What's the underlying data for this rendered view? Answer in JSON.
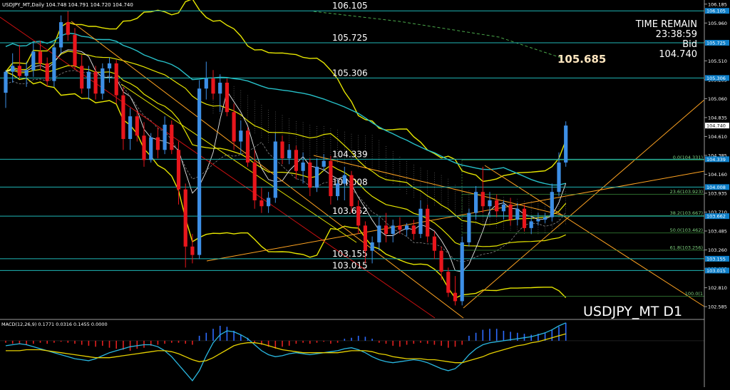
{
  "header": {
    "title_line": "USDJPY_MT,Daily  104.748 104.791 104.720 104.740"
  },
  "info_panel": {
    "time_remain_label": "TIME REMAIN",
    "time_remain_value": "23:38:59",
    "bid_label": "Bid",
    "bid_value": "104.740"
  },
  "highlight_price": "105.685",
  "symbol_label": "USDJPY_MT D1",
  "colors": {
    "background": "#000000",
    "bull": "#3d8fe6",
    "bear": "#e8161c",
    "level_line": "#1fb6b6",
    "bands": "#e6e600",
    "trend_orange": "#ffa321",
    "trend_red": "#cc1111",
    "ma_cyan": "#27c0c8",
    "price_tag": "#0e7fc9",
    "macd_pos": "#2d6bff",
    "macd_neg": "#e02020",
    "signal": "#e6d000",
    "macd_line": "#2ab7e0"
  },
  "chart_data": {
    "type": "candlestick",
    "symbol": "USDJPY_MT",
    "timeframe": "Daily",
    "ylim": [
      102.45,
      106.2
    ],
    "y_ticks": [
      106.185,
      105.96,
      105.735,
      105.51,
      105.285,
      105.06,
      104.835,
      104.61,
      104.385,
      104.16,
      103.935,
      103.71,
      103.485,
      103.26,
      103.035,
      102.81,
      102.585
    ],
    "current_price": 104.74,
    "candles": [
      {
        "o": 105.13,
        "h": 105.4,
        "l": 104.95,
        "c": 105.38
      },
      {
        "o": 105.38,
        "h": 105.6,
        "l": 105.25,
        "c": 105.45
      },
      {
        "o": 105.45,
        "h": 105.7,
        "l": 105.3,
        "c": 105.33
      },
      {
        "o": 105.33,
        "h": 105.5,
        "l": 105.2,
        "c": 105.4
      },
      {
        "o": 105.4,
        "h": 105.72,
        "l": 105.32,
        "c": 105.62
      },
      {
        "o": 105.62,
        "h": 105.75,
        "l": 105.4,
        "c": 105.48
      },
      {
        "o": 105.48,
        "h": 105.55,
        "l": 105.2,
        "c": 105.27
      },
      {
        "o": 105.27,
        "h": 105.72,
        "l": 105.2,
        "c": 105.67
      },
      {
        "o": 105.67,
        "h": 106.05,
        "l": 105.6,
        "c": 105.97
      },
      {
        "o": 105.97,
        "h": 106.1,
        "l": 105.75,
        "c": 105.82
      },
      {
        "o": 105.82,
        "h": 105.9,
        "l": 105.4,
        "c": 105.45
      },
      {
        "o": 105.45,
        "h": 105.58,
        "l": 105.12,
        "c": 105.18
      },
      {
        "o": 105.18,
        "h": 105.45,
        "l": 105.05,
        "c": 105.38
      },
      {
        "o": 105.38,
        "h": 105.45,
        "l": 105.05,
        "c": 105.12
      },
      {
        "o": 105.12,
        "h": 105.48,
        "l": 105.05,
        "c": 105.42
      },
      {
        "o": 105.42,
        "h": 105.55,
        "l": 105.25,
        "c": 105.48
      },
      {
        "o": 105.48,
        "h": 105.52,
        "l": 105.0,
        "c": 105.1
      },
      {
        "o": 105.1,
        "h": 105.2,
        "l": 104.45,
        "c": 104.58
      },
      {
        "o": 104.58,
        "h": 104.95,
        "l": 104.45,
        "c": 104.85
      },
      {
        "o": 104.85,
        "h": 104.92,
        "l": 104.55,
        "c": 104.62
      },
      {
        "o": 104.62,
        "h": 104.78,
        "l": 104.25,
        "c": 104.33
      },
      {
        "o": 104.33,
        "h": 104.65,
        "l": 104.3,
        "c": 104.6
      },
      {
        "o": 104.6,
        "h": 104.72,
        "l": 104.35,
        "c": 104.45
      },
      {
        "o": 104.45,
        "h": 104.85,
        "l": 104.4,
        "c": 104.75
      },
      {
        "o": 104.75,
        "h": 104.8,
        "l": 104.4,
        "c": 104.45
      },
      {
        "o": 104.45,
        "h": 104.55,
        "l": 103.8,
        "c": 103.98
      },
      {
        "o": 103.98,
        "h": 104.05,
        "l": 103.05,
        "c": 103.3
      },
      {
        "o": 103.3,
        "h": 103.45,
        "l": 103.1,
        "c": 103.2
      },
      {
        "o": 103.2,
        "h": 105.28,
        "l": 103.15,
        "c": 105.18
      },
      {
        "o": 105.18,
        "h": 105.5,
        "l": 105.05,
        "c": 105.3
      },
      {
        "o": 105.3,
        "h": 105.4,
        "l": 105.05,
        "c": 105.12
      },
      {
        "o": 105.12,
        "h": 105.35,
        "l": 104.9,
        "c": 105.25
      },
      {
        "o": 105.25,
        "h": 105.3,
        "l": 104.85,
        "c": 104.9
      },
      {
        "o": 104.9,
        "h": 105.0,
        "l": 104.45,
        "c": 104.55
      },
      {
        "o": 104.55,
        "h": 104.8,
        "l": 104.4,
        "c": 104.68
      },
      {
        "o": 104.68,
        "h": 104.72,
        "l": 104.25,
        "c": 104.3
      },
      {
        "o": 104.3,
        "h": 104.45,
        "l": 103.75,
        "c": 103.85
      },
      {
        "o": 103.85,
        "h": 104.0,
        "l": 103.7,
        "c": 103.78
      },
      {
        "o": 103.78,
        "h": 103.95,
        "l": 103.7,
        "c": 103.88
      },
      {
        "o": 103.88,
        "h": 104.65,
        "l": 103.82,
        "c": 104.55
      },
      {
        "o": 104.55,
        "h": 104.62,
        "l": 104.28,
        "c": 104.35
      },
      {
        "o": 104.35,
        "h": 104.52,
        "l": 104.28,
        "c": 104.45
      },
      {
        "o": 104.45,
        "h": 104.5,
        "l": 104.1,
        "c": 104.2
      },
      {
        "o": 104.2,
        "h": 104.42,
        "l": 104.05,
        "c": 104.3
      },
      {
        "o": 104.3,
        "h": 104.35,
        "l": 103.9,
        "c": 104.0
      },
      {
        "o": 104.0,
        "h": 104.35,
        "l": 103.95,
        "c": 104.25
      },
      {
        "o": 104.25,
        "h": 104.4,
        "l": 104.2,
        "c": 104.32
      },
      {
        "o": 104.32,
        "h": 104.38,
        "l": 103.8,
        "c": 103.9
      },
      {
        "o": 103.9,
        "h": 104.1,
        "l": 103.85,
        "c": 104.05
      },
      {
        "o": 104.05,
        "h": 104.25,
        "l": 103.85,
        "c": 104.15
      },
      {
        "o": 104.15,
        "h": 104.2,
        "l": 103.7,
        "c": 103.78
      },
      {
        "o": 103.78,
        "h": 103.85,
        "l": 103.45,
        "c": 103.55
      },
      {
        "o": 103.55,
        "h": 103.6,
        "l": 103.1,
        "c": 103.25
      },
      {
        "o": 103.25,
        "h": 103.42,
        "l": 103.1,
        "c": 103.35
      },
      {
        "o": 103.35,
        "h": 103.65,
        "l": 103.25,
        "c": 103.55
      },
      {
        "o": 103.55,
        "h": 103.7,
        "l": 103.35,
        "c": 103.45
      },
      {
        "o": 103.45,
        "h": 103.62,
        "l": 103.35,
        "c": 103.55
      },
      {
        "o": 103.55,
        "h": 103.65,
        "l": 103.45,
        "c": 103.5
      },
      {
        "o": 103.5,
        "h": 103.58,
        "l": 103.42,
        "c": 103.55
      },
      {
        "o": 103.55,
        "h": 103.62,
        "l": 103.38,
        "c": 103.45
      },
      {
        "o": 103.45,
        "h": 103.85,
        "l": 103.4,
        "c": 103.75
      },
      {
        "o": 103.75,
        "h": 103.8,
        "l": 103.35,
        "c": 103.42
      },
      {
        "o": 103.42,
        "h": 103.48,
        "l": 103.15,
        "c": 103.25
      },
      {
        "o": 103.25,
        "h": 103.3,
        "l": 102.9,
        "c": 103.0
      },
      {
        "o": 103.0,
        "h": 103.05,
        "l": 102.7,
        "c": 102.75
      },
      {
        "o": 102.75,
        "h": 102.95,
        "l": 102.6,
        "c": 102.65
      },
      {
        "o": 102.65,
        "h": 103.42,
        "l": 102.6,
        "c": 103.35
      },
      {
        "o": 103.35,
        "h": 103.75,
        "l": 103.3,
        "c": 103.7
      },
      {
        "o": 103.7,
        "h": 104.02,
        "l": 103.62,
        "c": 103.95
      },
      {
        "o": 103.95,
        "h": 104.25,
        "l": 103.7,
        "c": 103.78
      },
      {
        "o": 103.78,
        "h": 103.95,
        "l": 103.65,
        "c": 103.85
      },
      {
        "o": 103.85,
        "h": 103.92,
        "l": 103.65,
        "c": 103.72
      },
      {
        "o": 103.72,
        "h": 103.85,
        "l": 103.62,
        "c": 103.8
      },
      {
        "o": 103.8,
        "h": 103.88,
        "l": 103.55,
        "c": 103.62
      },
      {
        "o": 103.62,
        "h": 103.82,
        "l": 103.55,
        "c": 103.75
      },
      {
        "o": 103.75,
        "h": 103.8,
        "l": 103.48,
        "c": 103.52
      },
      {
        "o": 103.52,
        "h": 103.65,
        "l": 103.45,
        "c": 103.6
      },
      {
        "o": 103.6,
        "h": 103.7,
        "l": 103.55,
        "c": 103.62
      },
      {
        "o": 103.62,
        "h": 103.7,
        "l": 103.58,
        "c": 103.65
      },
      {
        "o": 103.65,
        "h": 104.05,
        "l": 103.6,
        "c": 103.95
      },
      {
        "o": 103.95,
        "h": 104.42,
        "l": 103.9,
        "c": 104.3
      },
      {
        "o": 104.3,
        "h": 104.79,
        "l": 104.25,
        "c": 104.74
      }
    ],
    "levels": [
      {
        "price": 106.105,
        "label": "106.105",
        "axis_tag": "106.105"
      },
      {
        "price": 105.725,
        "label": "105.725",
        "axis_tag": "105.725"
      },
      {
        "price": 105.306,
        "label": "105.306",
        "axis_tag": "105.306"
      },
      {
        "price": 104.339,
        "label": "104.339",
        "axis_tag": "104.339"
      },
      {
        "price": 104.008,
        "label": "104.008",
        "axis_tag": "104.008"
      },
      {
        "price": 103.662,
        "label": "103.662",
        "axis_tag": "103.662"
      },
      {
        "price": 103.155,
        "label": "103.155",
        "axis_tag": "103.155"
      },
      {
        "price": 103.015,
        "label": "103.015",
        "axis_tag": "103.015"
      }
    ],
    "fibonacci": [
      {
        "price": 104.331,
        "label": "0.0(104.331)"
      },
      {
        "price": 103.923,
        "label": "23.6(103.923)"
      },
      {
        "price": 103.667,
        "label": "38.2(103.667)"
      },
      {
        "price": 103.462,
        "label": "50.0(103.462)"
      },
      {
        "price": 103.256,
        "label": "61.8(103.256)"
      },
      {
        "price": 102.71,
        "label": "100.0(1"
      }
    ],
    "indicator": {
      "label": "MACD(12,26,9) 0.1771 0.0316 0.1455 0.0000",
      "ylim": [
        -0.4511,
        0.207
      ],
      "y_ticks": [
        0.207,
        0.0,
        -0.4511
      ],
      "histogram": [
        -0.02,
        -0.03,
        -0.03,
        -0.04,
        -0.03,
        -0.02,
        -0.03,
        -0.02,
        -0.01,
        -0.02,
        -0.03,
        -0.04,
        -0.05,
        -0.06,
        -0.05,
        -0.07,
        -0.08,
        -0.09,
        -0.1,
        -0.08,
        -0.07,
        -0.05,
        -0.04,
        -0.03,
        -0.02,
        -0.02,
        -0.03,
        -0.04,
        0.05,
        0.08,
        0.12,
        0.15,
        0.14,
        0.1,
        0.06,
        0.03,
        -0.02,
        -0.04,
        -0.06,
        -0.08,
        -0.06,
        -0.05,
        -0.03,
        -0.02,
        -0.03,
        -0.02,
        -0.01,
        -0.03,
        -0.02,
        0.02,
        0.03,
        0.05,
        0.04,
        0.02,
        -0.02,
        -0.03,
        -0.05,
        -0.06,
        -0.04,
        -0.03,
        -0.02,
        -0.03,
        -0.04,
        -0.05,
        -0.07,
        -0.06,
        -0.04,
        0.05,
        0.08,
        0.11,
        0.12,
        0.12,
        0.1,
        0.09,
        0.08,
        0.07,
        0.06,
        0.07,
        0.08,
        0.11,
        0.14,
        0.18
      ],
      "macd_line": [
        -0.05,
        -0.04,
        -0.03,
        -0.04,
        -0.06,
        -0.08,
        -0.1,
        -0.12,
        -0.14,
        -0.16,
        -0.18,
        -0.19,
        -0.2,
        -0.18,
        -0.15,
        -0.12,
        -0.1,
        -0.08,
        -0.06,
        -0.05,
        -0.04,
        -0.04,
        -0.06,
        -0.1,
        -0.16,
        -0.24,
        -0.32,
        -0.4,
        -0.3,
        -0.15,
        -0.02,
        0.06,
        0.1,
        0.09,
        0.06,
        0.02,
        -0.04,
        -0.1,
        -0.14,
        -0.16,
        -0.15,
        -0.13,
        -0.12,
        -0.13,
        -0.14,
        -0.13,
        -0.12,
        -0.11,
        -0.1,
        -0.08,
        -0.07,
        -0.09,
        -0.12,
        -0.16,
        -0.19,
        -0.21,
        -0.22,
        -0.21,
        -0.2,
        -0.19,
        -0.2,
        -0.22,
        -0.25,
        -0.28,
        -0.3,
        -0.28,
        -0.22,
        -0.14,
        -0.08,
        -0.04,
        -0.02,
        -0.01,
        0.0,
        0.01,
        0.02,
        0.03,
        0.04,
        0.06,
        0.08,
        0.11,
        0.15,
        0.18
      ],
      "signal_line": [
        -0.1,
        -0.1,
        -0.1,
        -0.09,
        -0.09,
        -0.09,
        -0.1,
        -0.11,
        -0.12,
        -0.13,
        -0.14,
        -0.15,
        -0.16,
        -0.17,
        -0.17,
        -0.17,
        -0.16,
        -0.15,
        -0.14,
        -0.13,
        -0.12,
        -0.11,
        -0.1,
        -0.1,
        -0.11,
        -0.13,
        -0.16,
        -0.19,
        -0.21,
        -0.2,
        -0.17,
        -0.13,
        -0.09,
        -0.05,
        -0.03,
        -0.02,
        -0.02,
        -0.03,
        -0.05,
        -0.07,
        -0.09,
        -0.1,
        -0.11,
        -0.12,
        -0.12,
        -0.12,
        -0.12,
        -0.12,
        -0.12,
        -0.11,
        -0.1,
        -0.1,
        -0.1,
        -0.11,
        -0.13,
        -0.14,
        -0.16,
        -0.17,
        -0.18,
        -0.18,
        -0.18,
        -0.19,
        -0.19,
        -0.2,
        -0.21,
        -0.22,
        -0.22,
        -0.2,
        -0.18,
        -0.16,
        -0.13,
        -0.11,
        -0.09,
        -0.07,
        -0.05,
        -0.04,
        -0.02,
        -0.01,
        0.01,
        0.03,
        0.05,
        0.07
      ]
    }
  }
}
